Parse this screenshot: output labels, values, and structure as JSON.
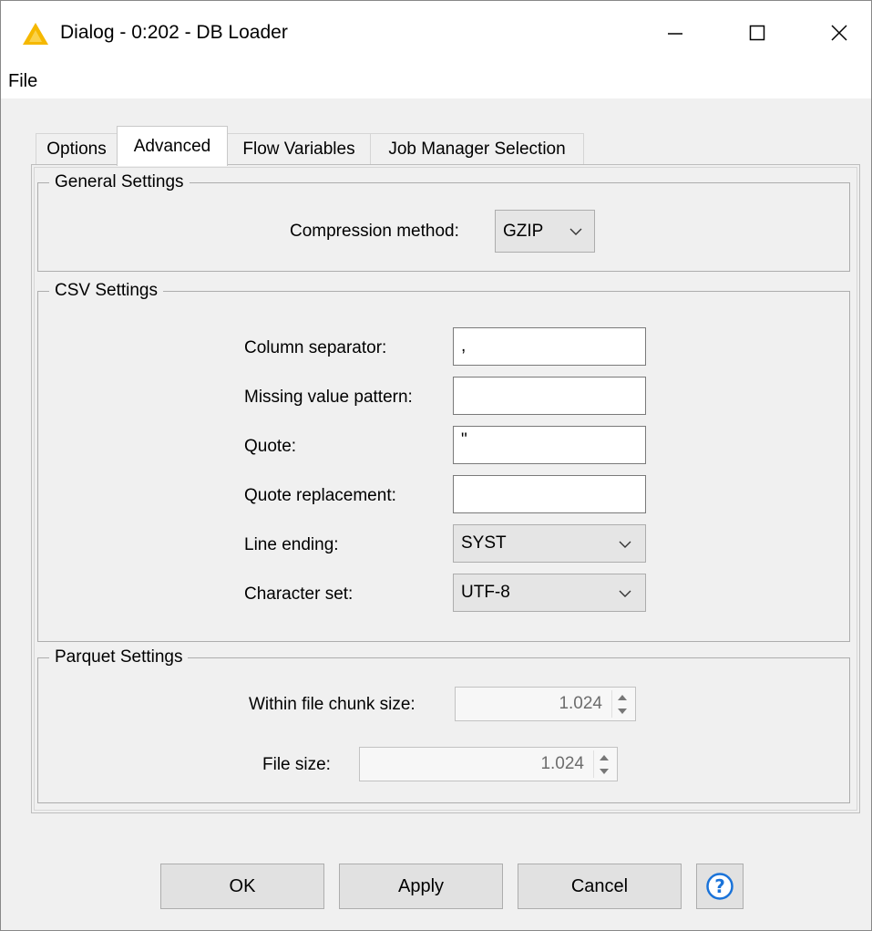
{
  "window": {
    "title": "Dialog - 0:202 - DB Loader",
    "icon": "warning-triangle-icon",
    "controls": [
      "minimize",
      "maximize",
      "close"
    ]
  },
  "menu": {
    "file": "File"
  },
  "tabs": [
    {
      "label": "Options",
      "active": false
    },
    {
      "label": "Advanced",
      "active": true
    },
    {
      "label": "Flow Variables",
      "active": false
    },
    {
      "label": "Job Manager Selection",
      "active": false
    }
  ],
  "general_settings": {
    "title": "General Settings",
    "compression_label": "Compression method:",
    "compression_value": "GZIP"
  },
  "csv_settings": {
    "title": "CSV Settings",
    "column_separator_label": "Column separator:",
    "column_separator_value": ",",
    "missing_value_label": "Missing value pattern:",
    "missing_value_value": "",
    "quote_label": "Quote:",
    "quote_value": "\"",
    "quote_replacement_label": "Quote replacement:",
    "quote_replacement_value": "",
    "line_ending_label": "Line ending:",
    "line_ending_value": "SYST",
    "charset_label": "Character set:",
    "charset_value": "UTF-8"
  },
  "parquet_settings": {
    "title": "Parquet Settings",
    "chunk_size_label": "Within file chunk size:",
    "chunk_size_value": "1.024",
    "file_size_label": "File size:",
    "file_size_value": "1.024"
  },
  "buttons": {
    "ok": "OK",
    "apply": "Apply",
    "cancel": "Cancel",
    "help_icon": "help-question-icon"
  },
  "colors": {
    "warning_icon": "#f5b800",
    "help_icon": "#1a73d9"
  }
}
